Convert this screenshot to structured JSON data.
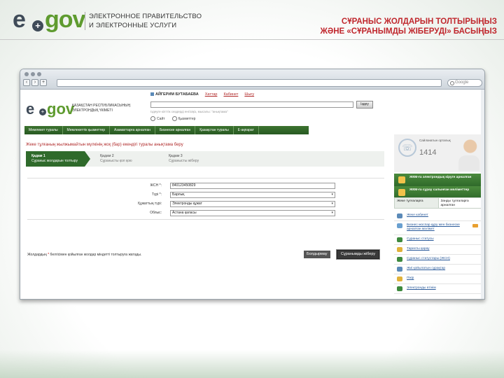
{
  "header": {
    "logo_e": "e",
    "logo_gov": "gov",
    "subtitle_line1": "ЭЛЕКТРОННОЕ ПРАВИТЕЛЬСТВО",
    "subtitle_line2": "И ЭЛЕКТРОННЫЕ УСЛУГИ",
    "title_line1": "СҰРАНЫС ЖОЛДАРЫН ТОЛТЫРЫҢЫЗ",
    "title_line2": "ЖӘНЕ «СҰРАНЫМДЫ ЖІБЕРУДІ» БАСЫҢЫЗ"
  },
  "browser": {
    "search_placeholder": "Google"
  },
  "site": {
    "logo_text_line1": "ҚАЗАҚСТАН РЕСПУБЛИКАСЫНЫҢ",
    "logo_text_line2": "ЭЛЕКТРОНДЫҚ ҮКІМЕТІ",
    "user_name": "АЙГЕРИМ БУТАБАЕВА",
    "link_messages": "Хаттар",
    "link_logout": "Шығу",
    "link_profile": "Кабинет",
    "search_button": "Іздеу",
    "search_hint": "Іздеуге кілттік сөздерді енгізіңіз, мысалы: \"анықтама\"",
    "radio_1": "Сайт",
    "radio_2": "Қызметтер",
    "menu": [
      "Мемлекет туралы",
      "Мемлекеттік қызметтер",
      "Азаматтарға арналған",
      "Бизнеске арналған",
      "Қазақстан туралы",
      "Е-ақпарат"
    ],
    "service_title": "Жеке тұлғаның жылжымайтын мүлкінің жоқ (бар) екендігі туралы анықтама беру",
    "steps": [
      {
        "num": "Қадам 1",
        "label": "Сұраныс жолдарын толтыру"
      },
      {
        "num": "Қадам 2",
        "label": "Сұранысты қол қою"
      },
      {
        "num": "Қадам 3",
        "label": "Сұранысты жіберу"
      }
    ],
    "form": {
      "iin_label": "ЖСН *:",
      "iin_value": "840123450829",
      "type_label": "Түрі *:",
      "type_value": "Барлық",
      "doc_label": "Құжаттың түрі:",
      "doc_value": "Электронды құжат",
      "region_label": "Облыс:",
      "region_value": "Астана қаласы"
    },
    "required_note_prefix": "Жолдардың ",
    "required_star": "*",
    "required_note_suffix": " белгісімен қойылған жолдар міндетті толтыруға жатады.",
    "btn_cancel": "Болдырмау",
    "btn_send": "Сұранымды жіберу",
    "sidebar": {
      "call_center_label": "Сайланатын орталық",
      "call_center_number": "1414",
      "bar_1": "ЖКМ-ға электрондық кіруге арналған",
      "bar_2": "ЖКМ-ға сұрау салынған мәліметтер",
      "tab_1": "Жеке тұлғаларға",
      "tab_2": "Заңды тұлғаларға арналған",
      "items": [
        "Жеке кабинет",
        "Бизнес-жоспар құру мен бизнеске арналған мәлімет",
        "Сұраныс статусы",
        "Тарихты қарау",
        "Сұраныс статустары (ЖСН)",
        "Жиі қойылатын сұрақтар",
        "Пікір",
        "Электронды өтінім"
      ]
    }
  }
}
